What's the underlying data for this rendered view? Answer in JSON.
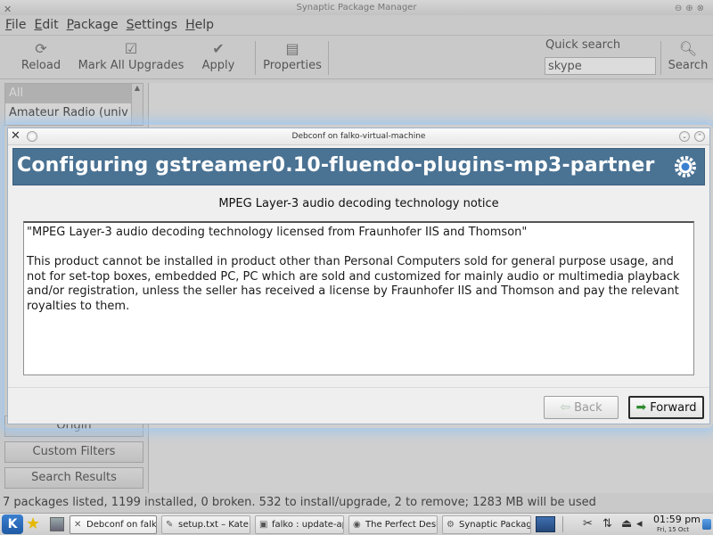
{
  "synaptic": {
    "window_title": "Synaptic Package Manager",
    "menu": [
      "File",
      "Edit",
      "Package",
      "Settings",
      "Help"
    ],
    "toolbar": {
      "reload": "Reload",
      "mark_all_upgrades": "Mark All Upgrades",
      "apply": "Apply",
      "properties": "Properties",
      "quick_search_label": "Quick search",
      "quick_search_value": "skype",
      "search": "Search"
    },
    "filters": [
      "All",
      "Amateur Radio (univ"
    ],
    "side_buttons": {
      "origin": "Origin",
      "custom_filters": "Custom Filters",
      "search_results": "Search Results"
    },
    "status": "7 packages listed, 1199 installed, 0 broken. 532 to install/upgrade, 2 to remove; 1283 MB will be used"
  },
  "dialog": {
    "title": "Debconf on falko-virtual-machine",
    "header": "Configuring gstreamer0.10-fluendo-plugins-mp3-partner",
    "subtitle": "MPEG Layer-3 audio decoding technology notice",
    "body": "\"MPEG Layer-3 audio decoding technology licensed from Fraunhofer IIS and Thomson\"\n\nThis product cannot be installed in product other than Personal Computers sold for general purpose usage, and not for set-top boxes, embedded PC, PC which are sold and customized for mainly audio or multimedia playback and/or registration, unless the seller has received a license by Fraunhofer IIS and Thomson and pay the relevant royalties to them.",
    "back_label": "Back",
    "forward_label": "Forward",
    "header_color": "#4a7293"
  },
  "taskbar": {
    "kde_logo": "K",
    "tasks": [
      "Debconf on falko",
      "setup.txt – Kate",
      "falko : update-ap",
      "The Perfect Desk",
      "Synaptic Package"
    ],
    "clock_time": "01:59 pm",
    "clock_date": "Fri, 15 Oct"
  }
}
